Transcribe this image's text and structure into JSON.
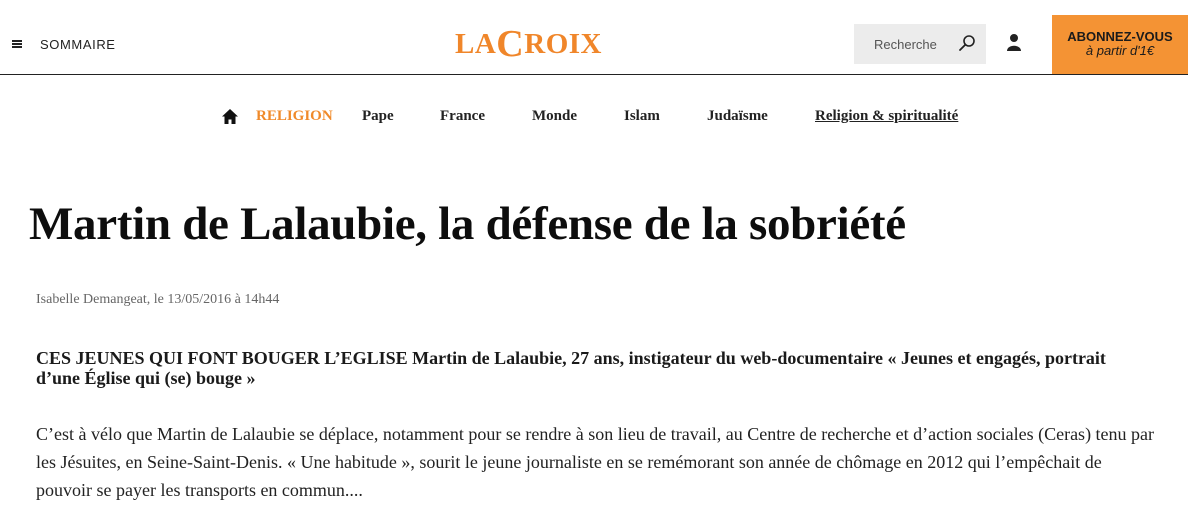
{
  "header": {
    "menu_label": "SOMMAIRE",
    "logo_text_la": "LA",
    "logo_text_c": "C",
    "logo_text_roix": "ROIX",
    "search_placeholder": "Recherche",
    "subscribe_line1": "ABONNEZ-VOUS",
    "subscribe_line2": "à partir d'1€"
  },
  "colors": {
    "brand": "#f0862a",
    "subscribe_bg": "#f49334",
    "search_bg": "#ececec"
  },
  "nav": {
    "items": [
      {
        "label": "RELIGION"
      },
      {
        "label": "Pape"
      },
      {
        "label": "France"
      },
      {
        "label": "Monde"
      },
      {
        "label": "Islam"
      },
      {
        "label": "Judaïsme"
      },
      {
        "label": "Religion & spiritualité"
      }
    ]
  },
  "article": {
    "title": "Martin de Lalaubie, la défense de la sobriété",
    "byline": "Isabelle Demangeat, le 13/05/2016 à 14h44",
    "chapo": "CES JEUNES QUI FONT BOUGER L’EGLISE Martin de Lalaubie, 27 ans, instigateur du web-documentaire « Jeunes et engagés, portrait d’une Église qui (se) bouge »",
    "body": "C’est à vélo que Martin de Lalaubie se déplace, notamment pour se rendre à son lieu de travail, au Centre de recherche et d’action sociales (Ceras) tenu par les Jésuites, en Seine-Saint-Denis. « Une habitude », sourit le jeune journaliste en se remémorant son année de chômage en 2012 qui l’empêchait de pouvoir se payer les transports en commun...."
  }
}
